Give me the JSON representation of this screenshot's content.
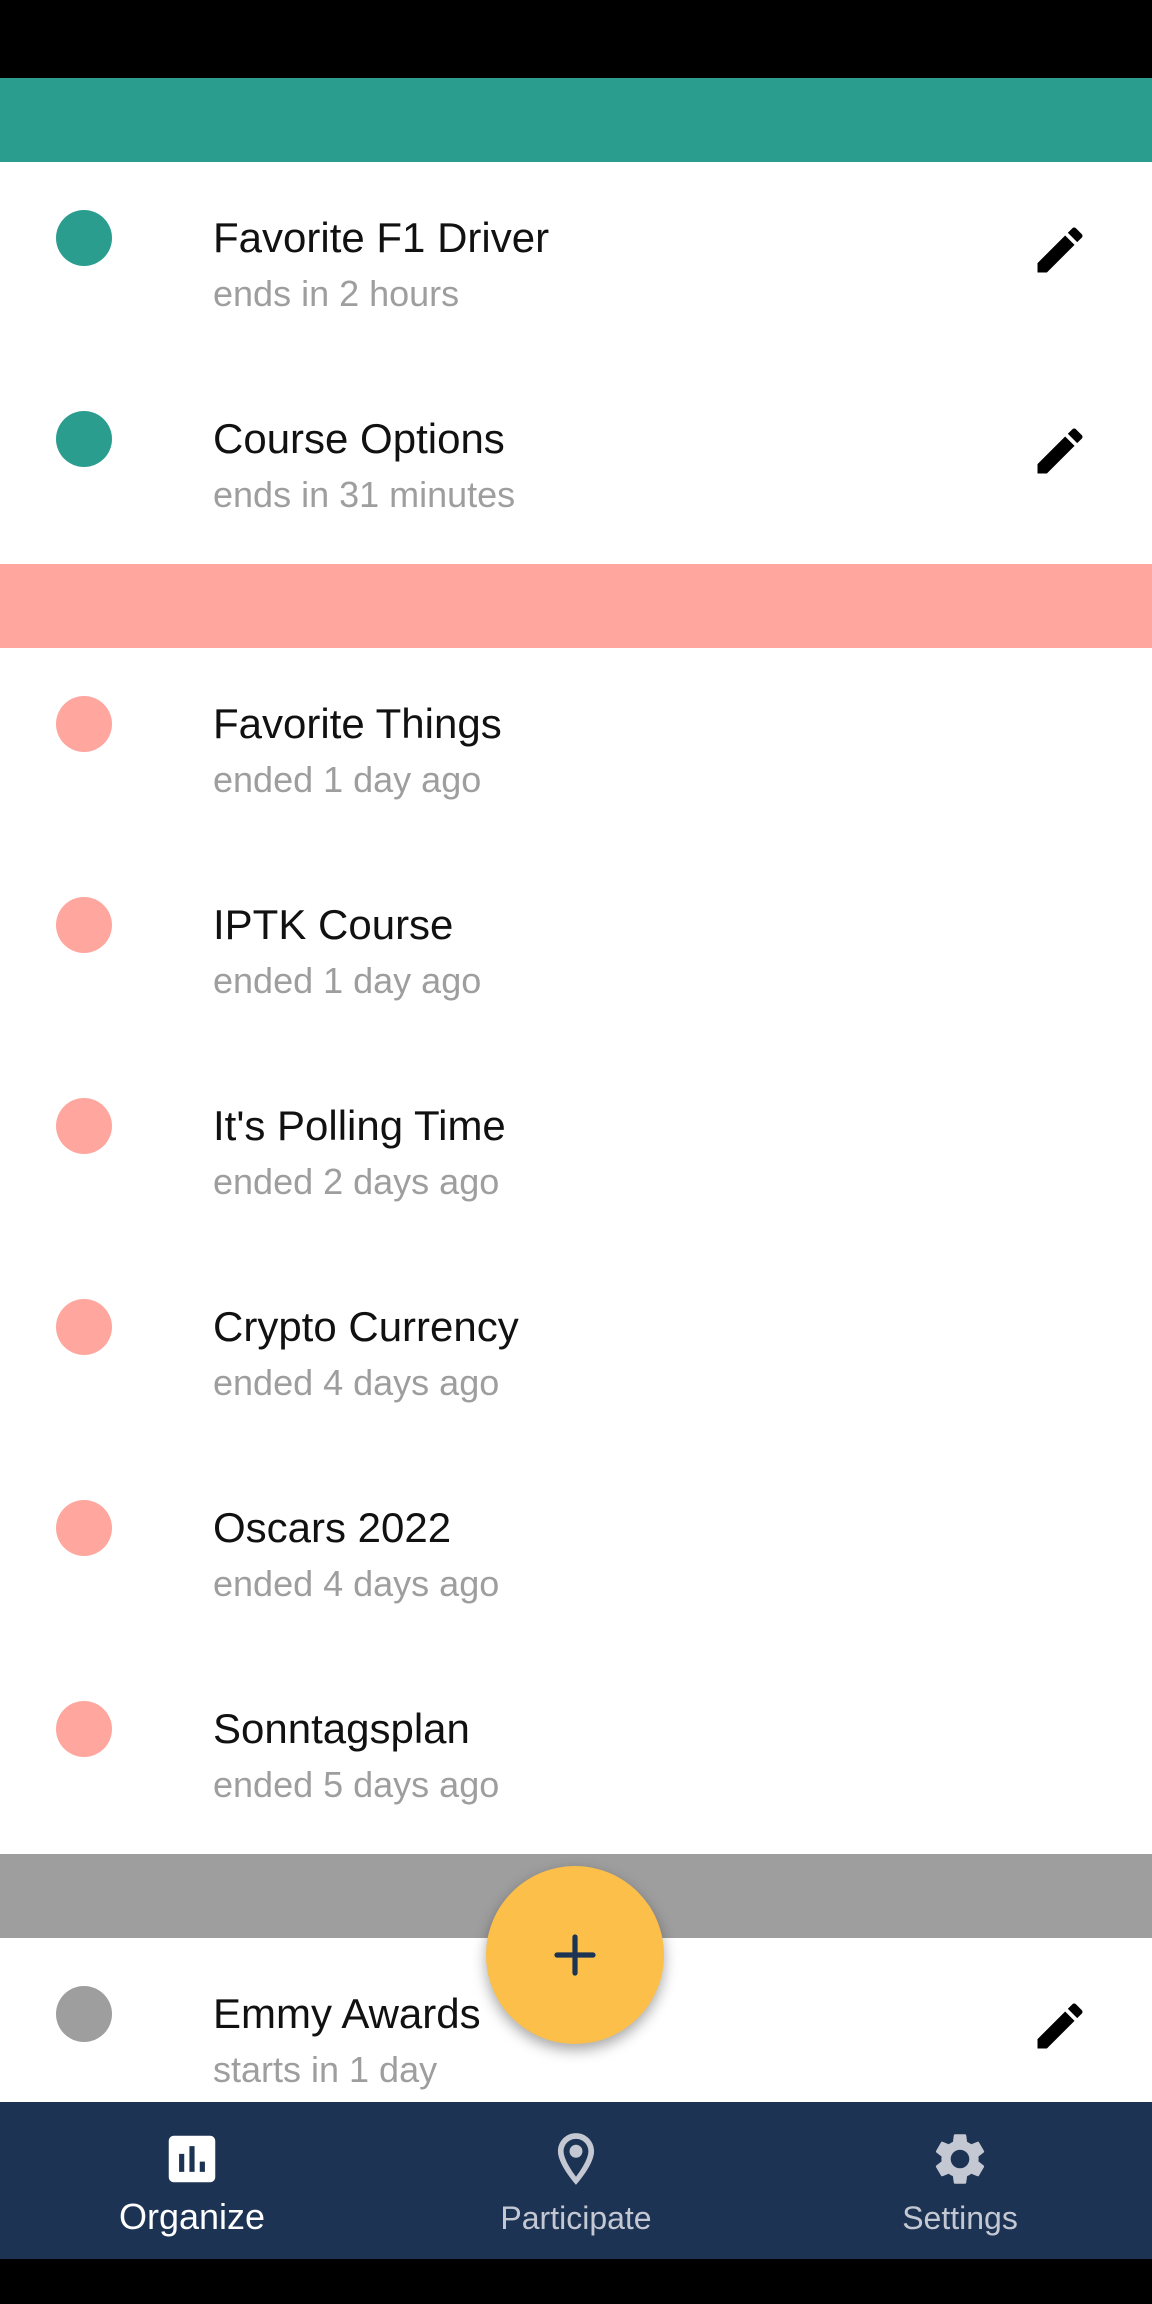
{
  "colors": {
    "active": "#2a9d8f",
    "ended": "#ffa69e",
    "upcoming": "#9e9e9e",
    "fab": "#fbbf4a",
    "nav_bg": "#1d3354",
    "nav_active": "#ffffff",
    "nav_inactive": "#c3c8d2"
  },
  "sections": {
    "active": {
      "items": [
        {
          "title": "Favorite F1 Driver",
          "subtitle": "ends in 2 hours",
          "icon": "pencil-icon"
        },
        {
          "title": "Course Options",
          "subtitle": "ends in 31 minutes",
          "icon": "pencil-icon"
        }
      ]
    },
    "ended": {
      "items": [
        {
          "title": "Favorite Things",
          "subtitle": "ended 1 day ago"
        },
        {
          "title": "IPTK Course",
          "subtitle": "ended 1 day ago"
        },
        {
          "title": "It's Polling Time",
          "subtitle": "ended 2 days ago"
        },
        {
          "title": "Crypto Currency",
          "subtitle": "ended 4 days ago"
        },
        {
          "title": "Oscars 2022",
          "subtitle": "ended 4 days ago"
        },
        {
          "title": "Sonntagsplan",
          "subtitle": "ended 5 days ago"
        }
      ]
    },
    "upcoming": {
      "items": [
        {
          "title": "Emmy Awards",
          "subtitle": "starts in 1 day",
          "icon": "pencil-icon"
        }
      ]
    }
  },
  "fab": {
    "icon": "plus-icon"
  },
  "nav": {
    "items": [
      {
        "label": "Organize",
        "icon": "bar-chart-icon",
        "active": true
      },
      {
        "label": "Participate",
        "icon": "location-pin-icon",
        "active": false
      },
      {
        "label": "Settings",
        "icon": "gear-icon",
        "active": false
      }
    ]
  }
}
